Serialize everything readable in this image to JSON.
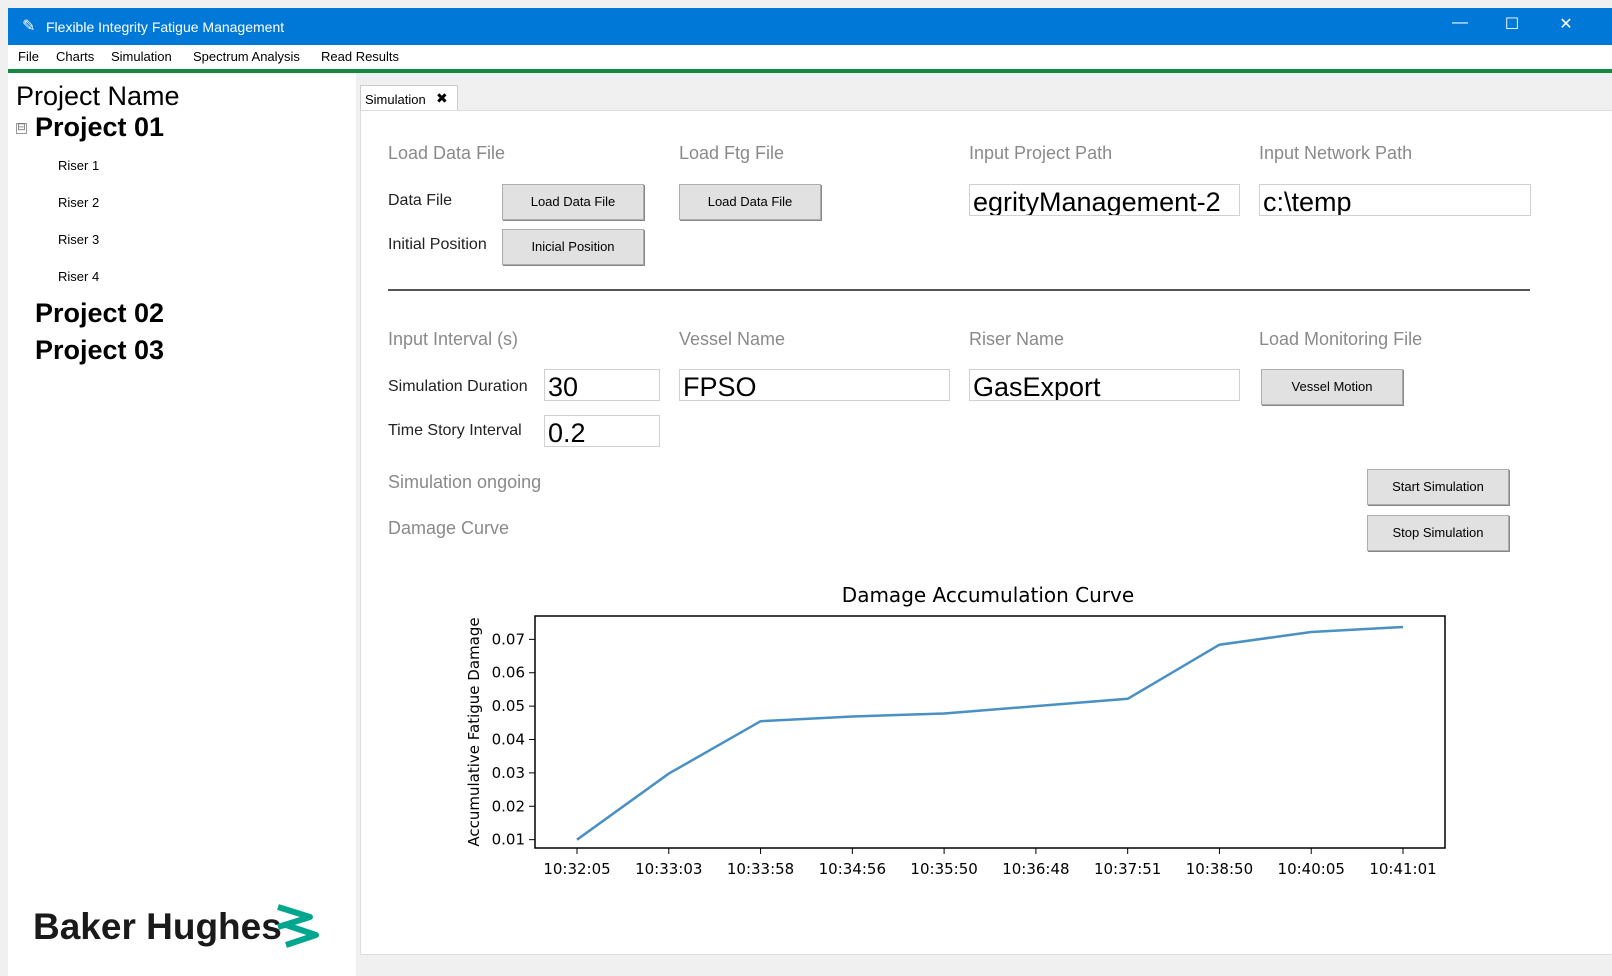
{
  "window": {
    "title": "Flexible Integrity Fatigue Management"
  },
  "menu": [
    "File",
    "Charts",
    "Simulation",
    "Spectrum Analysis",
    "Read Results"
  ],
  "tree": {
    "header": "Project Name",
    "toggle": "⊟",
    "projects": [
      {
        "name": "Project 01",
        "risers": [
          "Riser 1",
          "Riser 2",
          "Riser 3",
          "Riser 4"
        ]
      },
      {
        "name": "Project 02"
      },
      {
        "name": "Project 03"
      }
    ]
  },
  "brand": {
    "name": "Baker Hughes"
  },
  "tabs": [
    {
      "label": "Simulation",
      "close": "✖"
    }
  ],
  "form": {
    "load_data_file": "Load Data File",
    "load_ftg_file": "Load Ftg File",
    "input_project_path": "Input Project Path",
    "input_network_path": "Input Network Path",
    "data_file_label": "Data File",
    "data_file_button": "Load Data File",
    "ftg_file_button": "Load Data File",
    "project_path_value": "egrityManagement-2",
    "network_path_value": "c:\\temp",
    "initial_position_label": "Initial Position",
    "initial_position_button": "Inicial Position",
    "input_interval": "Input Interval (s)",
    "vessel_name": "Vessel Name",
    "riser_name": "Riser Name",
    "load_monitoring_file": "Load Monitoring File",
    "simulation_duration_label": "Simulation Duration",
    "simulation_duration_value": "30",
    "vessel_name_value": "FPSO",
    "riser_name_value": "GasExport",
    "vessel_motion_button": "Vessel Motion",
    "time_story_label": "Time Story Interval",
    "time_story_value": "0.2",
    "simulation_ongoing": "Simulation ongoing",
    "damage_curve": "Damage Curve",
    "start_button": "Start Simulation",
    "stop_button": "Stop Simulation"
  },
  "colors": {
    "titlebar": "#0078d7",
    "menu_accent": "#12893f",
    "series": "#4a90c2"
  },
  "chart_data": {
    "type": "line",
    "title": "Damage Accumulation Curve",
    "xlabel": "",
    "ylabel": "Accumulative Fatigue Damage",
    "x": [
      "10:32:05",
      "10:33:03",
      "10:33:58",
      "10:34:56",
      "10:35:50",
      "10:36:48",
      "10:37:51",
      "10:38:50",
      "10:40:05",
      "10:41:01"
    ],
    "values": [
      0.01,
      0.0298,
      0.0455,
      0.0469,
      0.0478,
      0.05,
      0.0522,
      0.0684,
      0.0722,
      0.0737
    ],
    "yticks": [
      "0.01",
      "0.02",
      "0.03",
      "0.04",
      "0.05",
      "0.06",
      "0.07"
    ],
    "ylim": [
      0.0075,
      0.077
    ],
    "grid": false
  }
}
